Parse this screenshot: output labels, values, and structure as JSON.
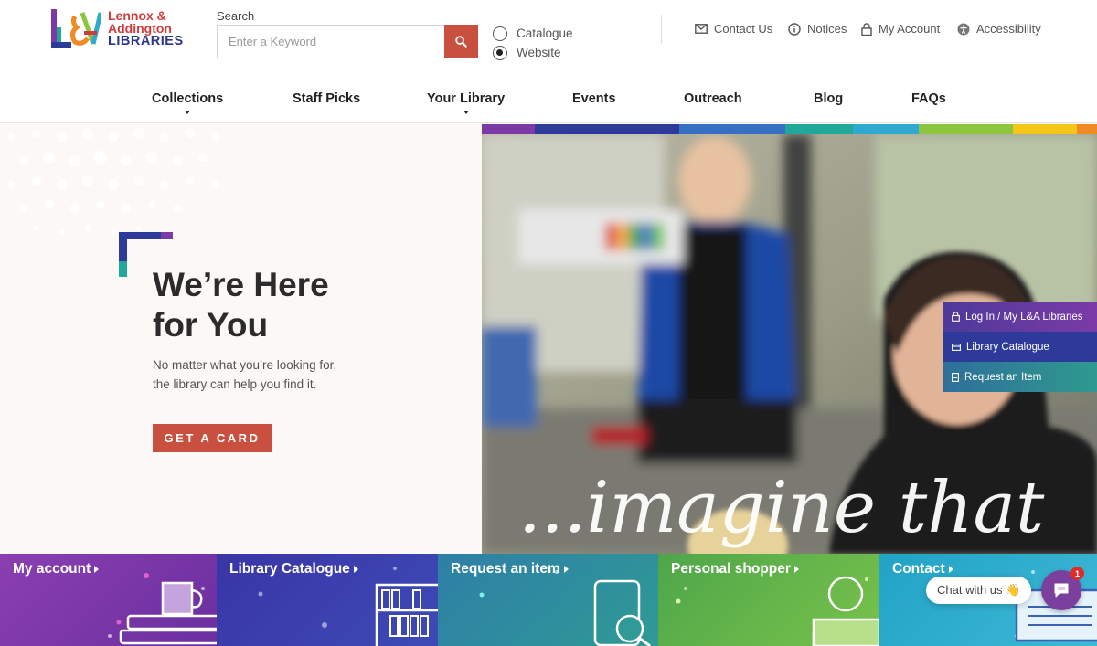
{
  "logo": {
    "line1": "Lennox &",
    "line2": "Addington",
    "line3": "LIBRARIES"
  },
  "search": {
    "label": "Search",
    "placeholder": "Enter a Keyword",
    "button_icon": "search-icon",
    "scope_options": [
      {
        "label": "Catalogue",
        "selected": false
      },
      {
        "label": "Website",
        "selected": true
      }
    ]
  },
  "utility_links": [
    {
      "label": "Contact Us",
      "icon": "mail-icon"
    },
    {
      "label": "Notices",
      "icon": "info-icon"
    },
    {
      "label": "My Account",
      "icon": "lock-icon"
    },
    {
      "label": "Accessibility",
      "icon": "accessibility-icon"
    }
  ],
  "nav": [
    {
      "label": "Collections",
      "has_dropdown": true
    },
    {
      "label": "Staff Picks",
      "has_dropdown": false
    },
    {
      "label": "Your Library",
      "has_dropdown": true
    },
    {
      "label": "Events",
      "has_dropdown": false
    },
    {
      "label": "Outreach",
      "has_dropdown": false
    },
    {
      "label": "Blog",
      "has_dropdown": false
    },
    {
      "label": "FAQs",
      "has_dropdown": false
    }
  ],
  "hero": {
    "title_line1": "We’re Here",
    "title_line2": "for You",
    "subtitle_line1": "No matter what you’re looking for,",
    "subtitle_line2": "the library can help you find it.",
    "cta_label": "GET A CARD",
    "overlay_text": "...imagine that"
  },
  "side_menu": [
    {
      "label": "Log In / My L&A Libraries",
      "icon": "lock-icon",
      "color": "#5b3b9c"
    },
    {
      "label": "Library Catalogue",
      "icon": "card-icon",
      "color": "#2e3a9a"
    },
    {
      "label": "Request an Item",
      "icon": "document-icon",
      "color": "#2f8f96"
    }
  ],
  "tiles": [
    {
      "label": "My account",
      "icon": "books-mug-icon",
      "color": "#7c3aa8"
    },
    {
      "label": "Library Catalogue",
      "icon": "bookshelf-icon",
      "color": "#3a3ba4"
    },
    {
      "label": "Request an item",
      "icon": "book-magnifier-icon",
      "color": "#2f8f9e"
    },
    {
      "label": "Personal shopper",
      "icon": "person-reading-icon",
      "color": "#5bb24a"
    },
    {
      "label": "Contact",
      "icon": "laptop-hand-icon",
      "color": "#2aa3c9"
    }
  ],
  "chat": {
    "prompt": "Chat with us 👋",
    "badge_count": "1",
    "icon": "chat-icon"
  },
  "brand_colors": {
    "accent": "#c9503f",
    "navy": "#2a3590",
    "strip": [
      "#7b3aa6",
      "#2e3a9a",
      "#3570c4",
      "#21a89a",
      "#2fa9d0",
      "#8cc63f",
      "#f5c518",
      "#f08a24"
    ]
  }
}
